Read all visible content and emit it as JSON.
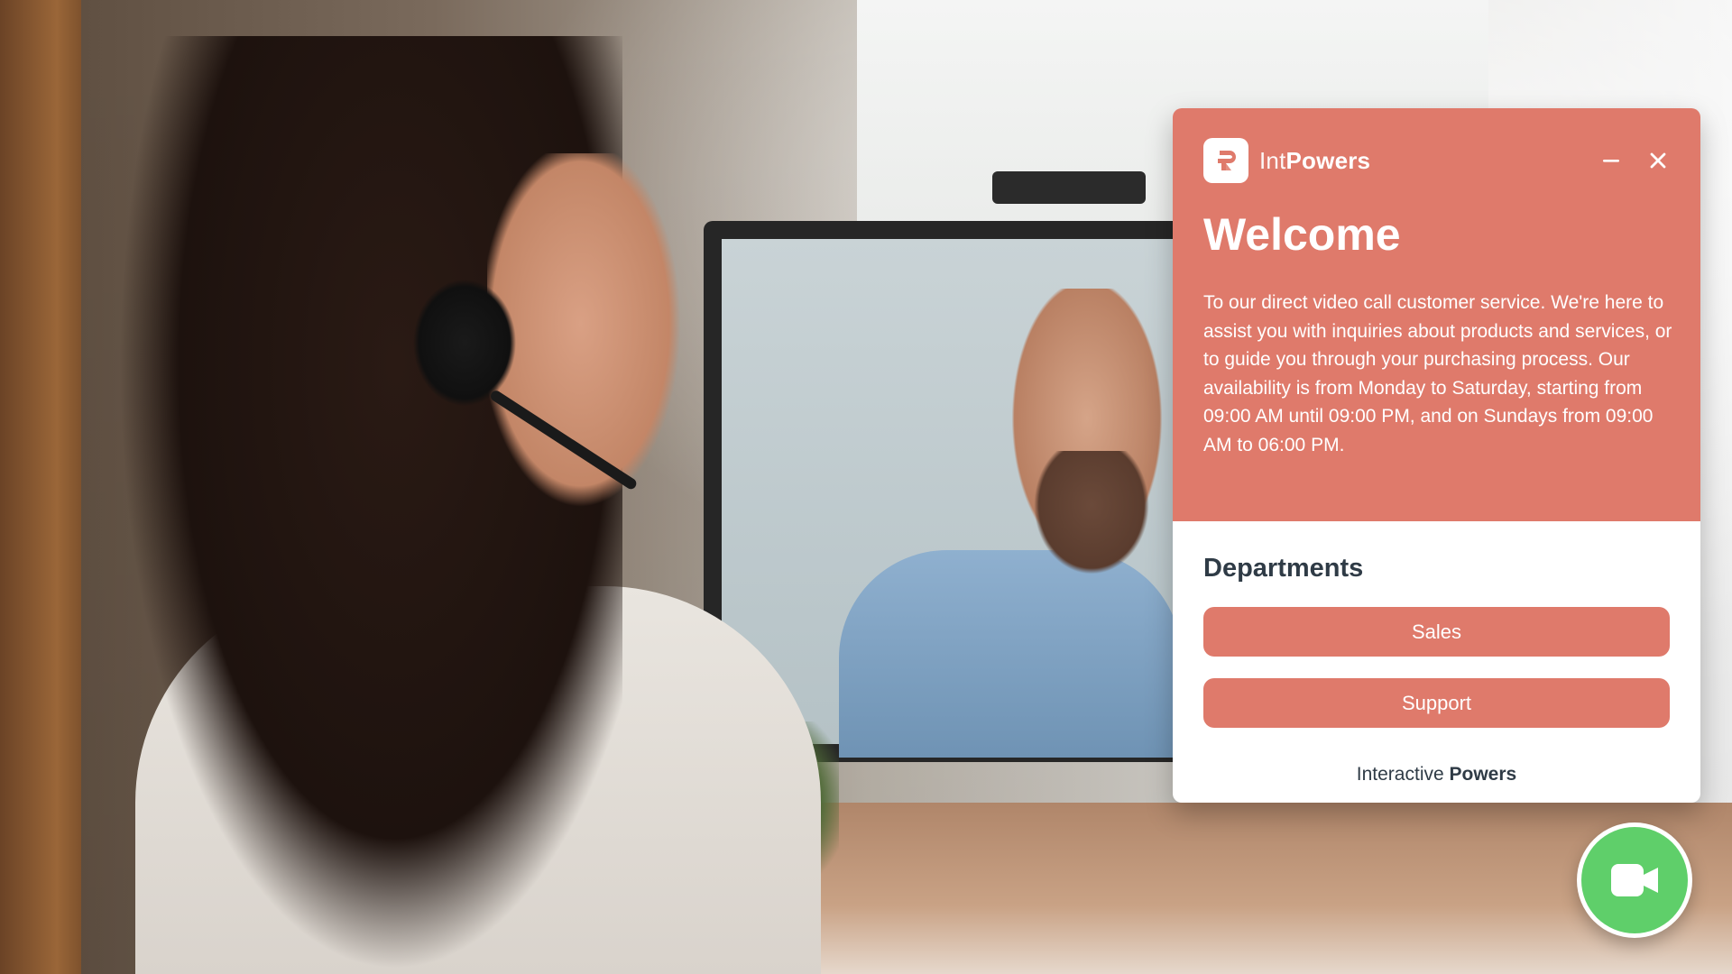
{
  "brand": {
    "name_part1": "Int",
    "name_part2": "Powers",
    "logo_icon": "intpowers-logo-icon"
  },
  "header": {
    "minimize_icon": "minimize-icon",
    "close_icon": "close-icon",
    "title": "Welcome",
    "intro_text": "To our direct video call customer service. We're here to assist you with inquiries about products and services, or to guide you through your purchasing process. Our availability is from Monday to Saturday, starting from 09:00 AM until 09:00 PM, and on Sundays from 09:00 AM to 06:00 PM."
  },
  "departments": {
    "title": "Departments",
    "items": [
      {
        "label": "Sales"
      },
      {
        "label": "Support"
      }
    ]
  },
  "footer": {
    "part1": "Interactive ",
    "part2": "Powers"
  },
  "video_button": {
    "icon": "video-camera-icon"
  },
  "colors": {
    "accent": "#df7a6b",
    "fab_green": "#5fcf6a",
    "text_dark": "#2f3b46",
    "white": "#ffffff"
  }
}
